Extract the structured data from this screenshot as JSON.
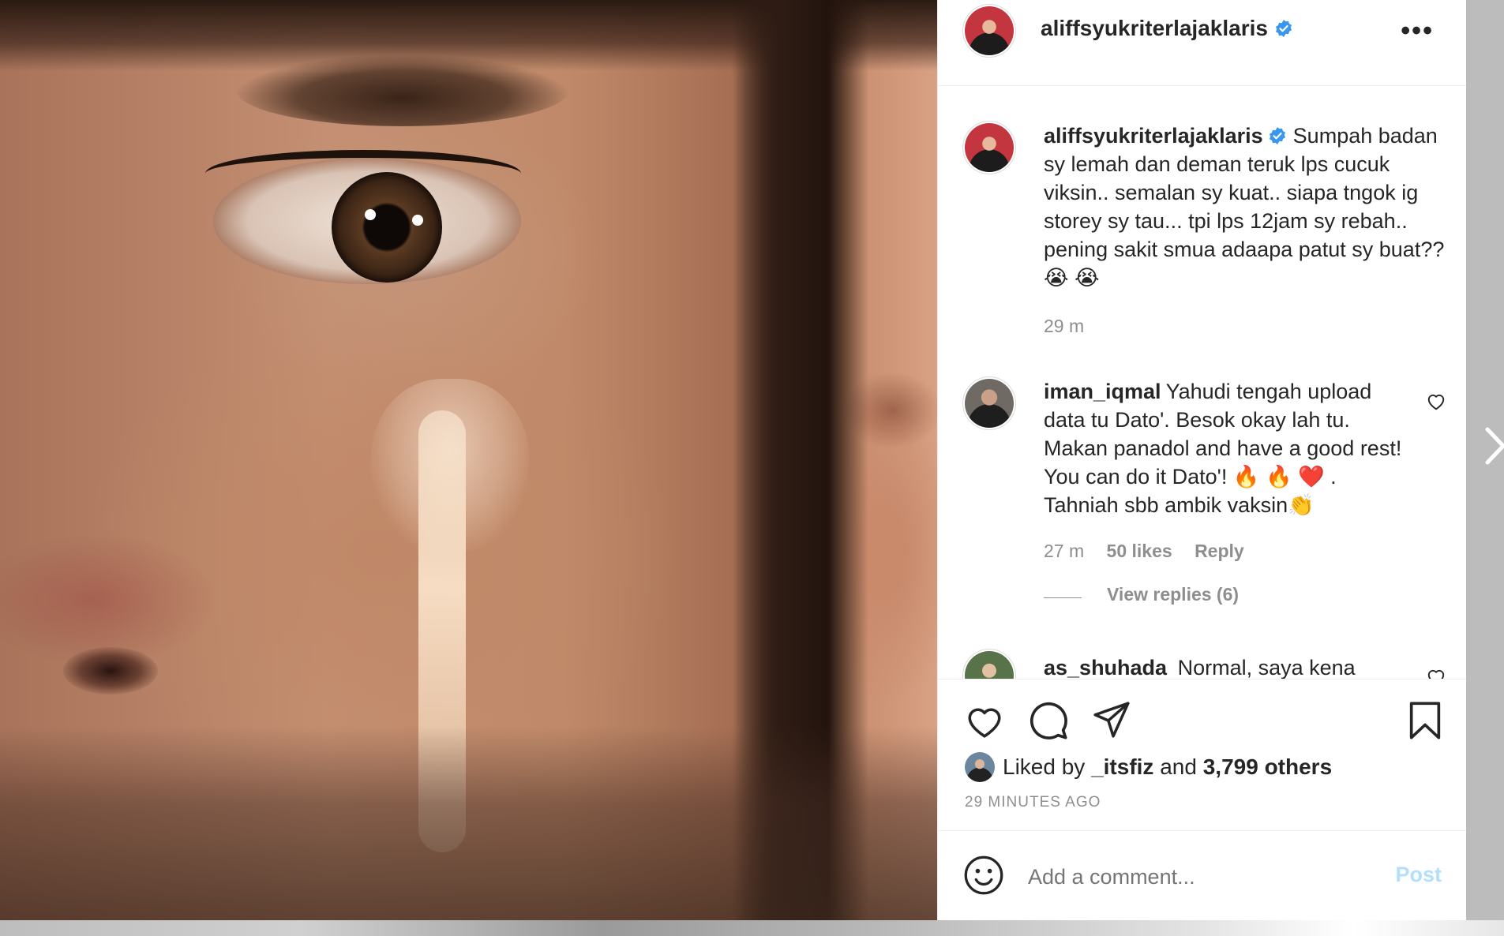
{
  "post": {
    "author": "aliffsyukriterlajaklaris",
    "author_verified": true,
    "caption": "Sumpah badan sy lemah dan deman teruk lps cucuk viksin.. semalan sy kuat.. siapa tngok ig storey sy tau... tpi lps 12jam sy rebah.. pening sakit smua adaapa patut sy buat?? 😭 😭",
    "caption_time": "29 m",
    "more_icon": "more-horizontal-icon"
  },
  "comments": [
    {
      "username": "iman_iqmal",
      "text": "Yahudi tengah upload data tu Dato'. Besok okay lah tu. Makan panadol and have a good rest! You can do it Dato'! 🔥 🔥 ❤️ . Tahniah sbb ambik vaksin👏",
      "time": "27 m",
      "likes": "50 likes",
      "reply": "Reply",
      "view_replies": "View replies (6)"
    },
    {
      "username": "as_shuhada",
      "text": "Normal, saya kena"
    }
  ],
  "actions": {
    "icons": [
      "heart-icon",
      "comment-icon",
      "share-icon",
      "bookmark-icon"
    ],
    "liked_by_prefix": "Liked by",
    "liked_by_user": "_itsfiz",
    "liked_by_and": "and",
    "liked_by_others": "3,799 others",
    "timestamp": "29 MINUTES AGO"
  },
  "add_comment": {
    "placeholder": "Add a comment...",
    "post_label": "Post",
    "emoji_icon": "smiley-icon"
  },
  "colors": {
    "verified_blue": "#3897f0",
    "post_button_disabled": "#b2dffc",
    "muted_text": "#8e8e8e"
  }
}
